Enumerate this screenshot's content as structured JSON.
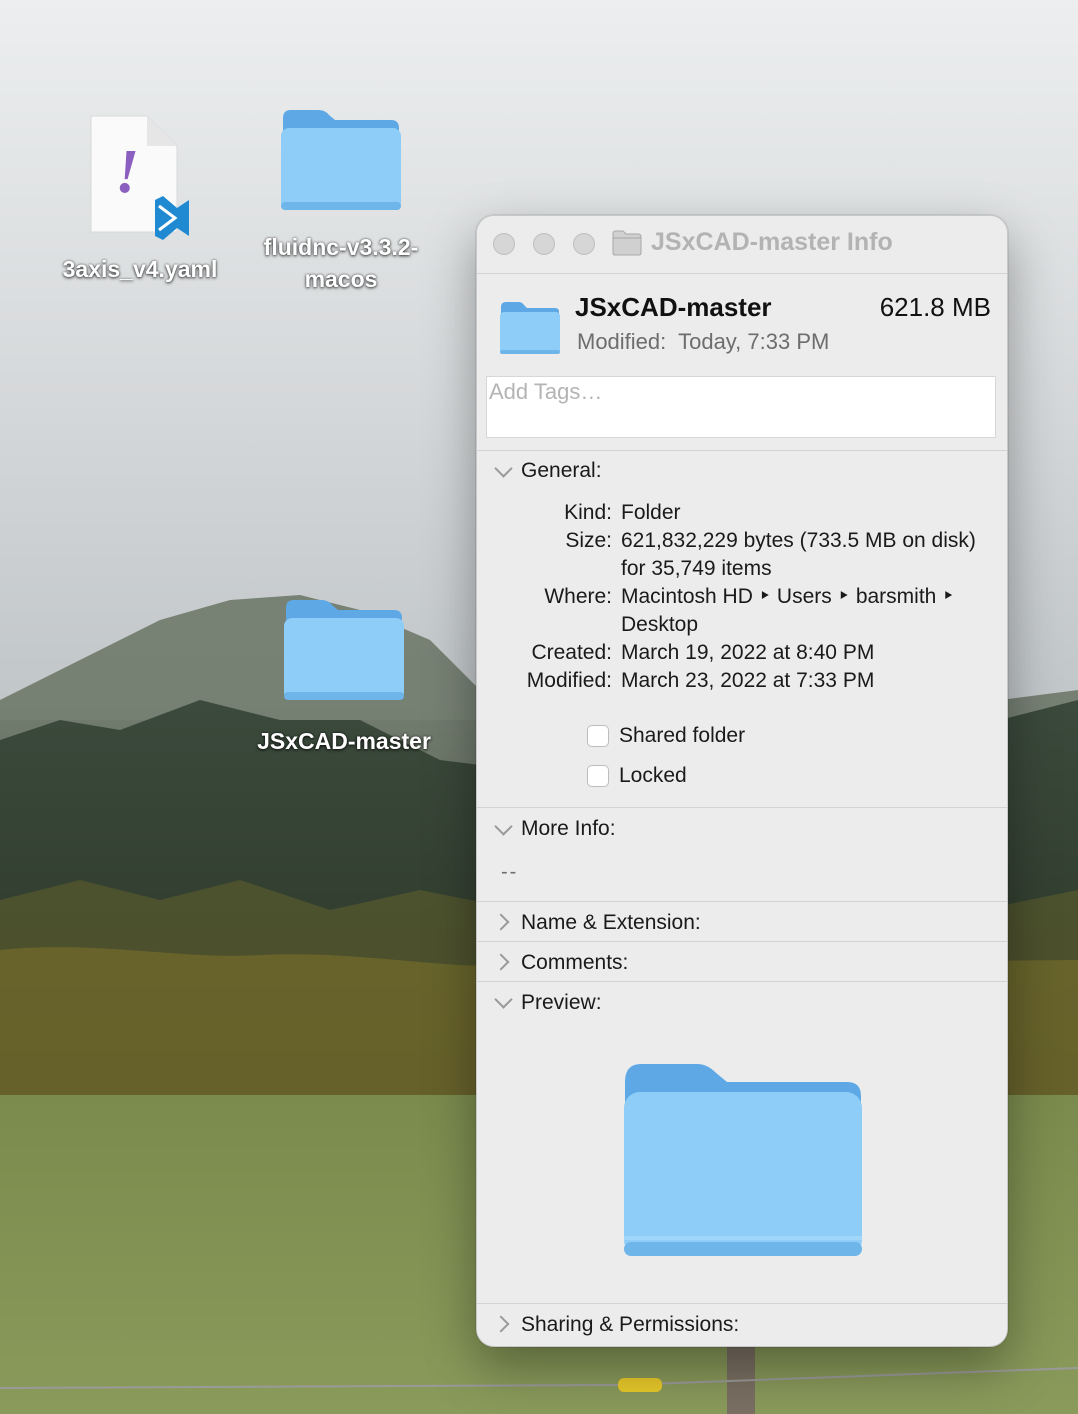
{
  "desktop": {
    "icons": [
      {
        "label": "3axis_v4.yaml",
        "icon": "yaml-file-icon"
      },
      {
        "label": "fluidnc-v3.3.2-\nmacos",
        "icon": "folder-icon"
      },
      {
        "label": "JSxCAD-master",
        "icon": "folder-icon"
      }
    ]
  },
  "window": {
    "title": "JSxCAD-master Info",
    "controls": [
      "close",
      "minimize",
      "zoom"
    ],
    "header": {
      "name": "JSxCAD-master",
      "size": "621.8 MB",
      "modified": "Modified:  Today, 7:33 PM"
    },
    "tags_placeholder": "Add Tags…",
    "general": {
      "heading": "General:",
      "rows": [
        {
          "label": "Kind:",
          "value": "Folder"
        },
        {
          "label": "Size:",
          "value": "621,832,229 bytes (733.5 MB on disk) for 35,749 items"
        },
        {
          "label": "Where:",
          "value": "Macintosh HD ‣ Users ‣ barsmith ‣ Desktop"
        },
        {
          "label": "Created:",
          "value": "March 19, 2022 at 8:40 PM"
        },
        {
          "label": "Modified:",
          "value": "March 23, 2022 at 7:33 PM"
        }
      ],
      "checkboxes": [
        {
          "label": "Shared folder",
          "checked": false
        },
        {
          "label": "Locked",
          "checked": false
        }
      ]
    },
    "more_info": {
      "heading": "More Info:",
      "value": "--"
    },
    "name_extension": {
      "heading": "Name & Extension:"
    },
    "comments": {
      "heading": "Comments:"
    },
    "preview": {
      "heading": "Preview:"
    },
    "sharing": {
      "heading": "Sharing & Permissions:"
    }
  },
  "colors": {
    "folder_body": "#8ecdf7",
    "folder_tab": "#5ea8e6",
    "yaml_exclaim": "#8b5fbf",
    "vscode_blue": "#1f8ad2"
  }
}
